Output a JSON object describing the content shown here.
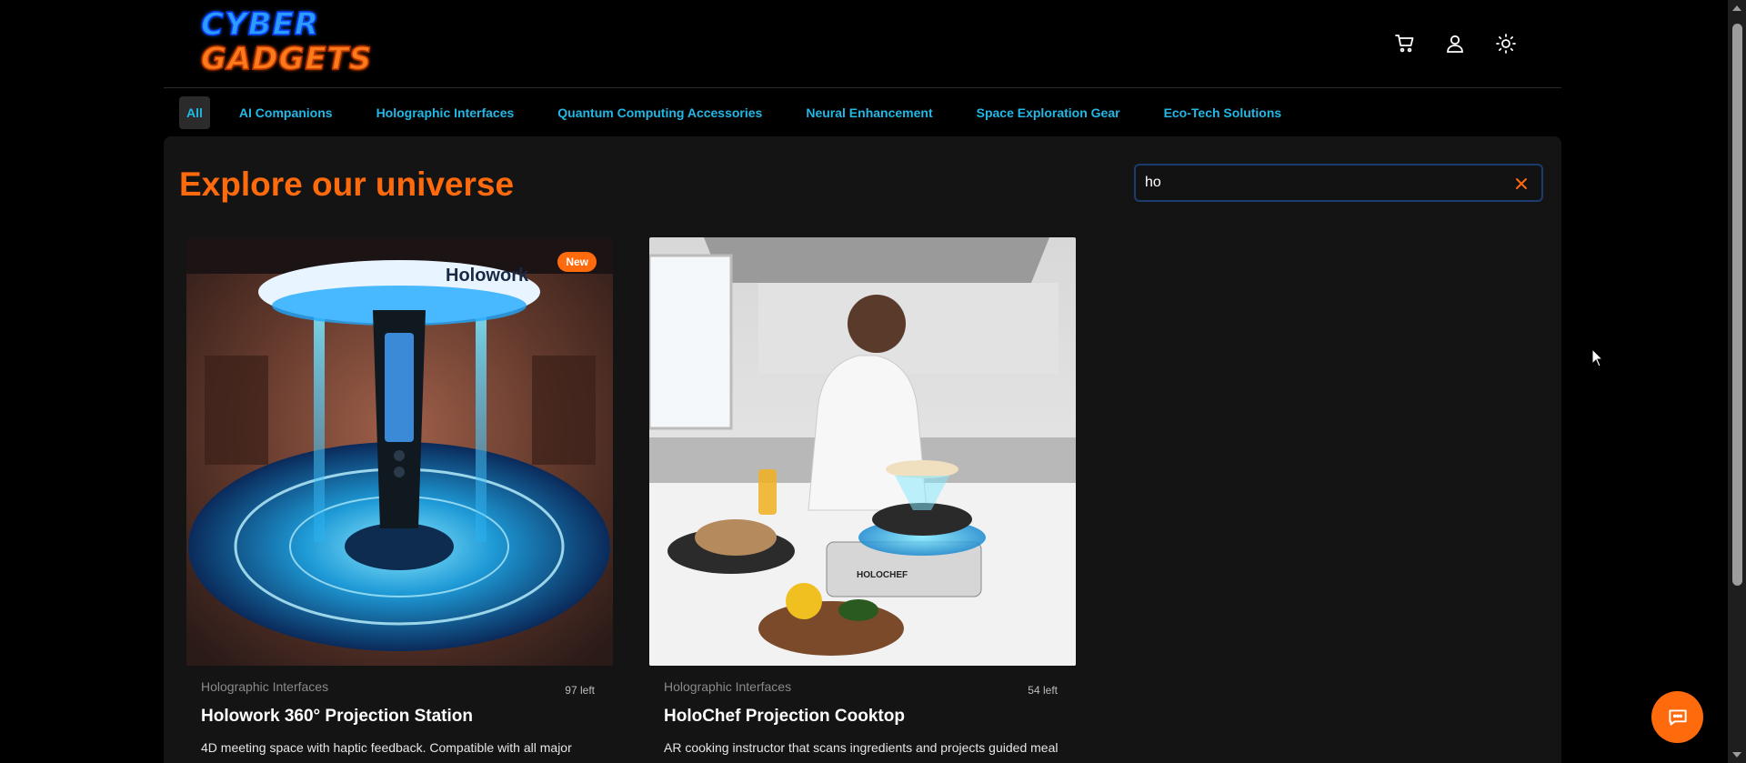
{
  "header": {
    "logo_line1": "CYBER",
    "logo_line2": "GADGETS",
    "icons": [
      "cart-icon",
      "user-icon",
      "sun-icon"
    ]
  },
  "nav": {
    "items": [
      {
        "label": "All",
        "active": true
      },
      {
        "label": "AI Companions",
        "active": false
      },
      {
        "label": "Holographic Interfaces",
        "active": false
      },
      {
        "label": "Quantum Computing Accessories",
        "active": false
      },
      {
        "label": "Neural Enhancement",
        "active": false
      },
      {
        "label": "Space Exploration Gear",
        "active": false
      },
      {
        "label": "Eco-Tech Solutions",
        "active": false
      }
    ]
  },
  "main": {
    "headline": "Explore our universe",
    "search": {
      "value": "ho",
      "placeholder": ""
    }
  },
  "products": [
    {
      "badge": "New",
      "category": "Holographic Interfaces",
      "stock": "97 left",
      "title": "Holowork 360° Projection Station",
      "description": "4D meeting space with haptic feedback. Compatible with all major",
      "image_text": "Holowork"
    },
    {
      "badge": "",
      "category": "Holographic Interfaces",
      "stock": "54 left",
      "title": "HoloChef Projection Cooktop",
      "description": "AR cooking instructor that scans ingredients and projects guided meal",
      "image_text": "HOLOCHEF"
    }
  ],
  "colors": {
    "accent": "#ff6a0d",
    "link": "#22b8e6",
    "background": "#000000",
    "panel": "#141414"
  }
}
